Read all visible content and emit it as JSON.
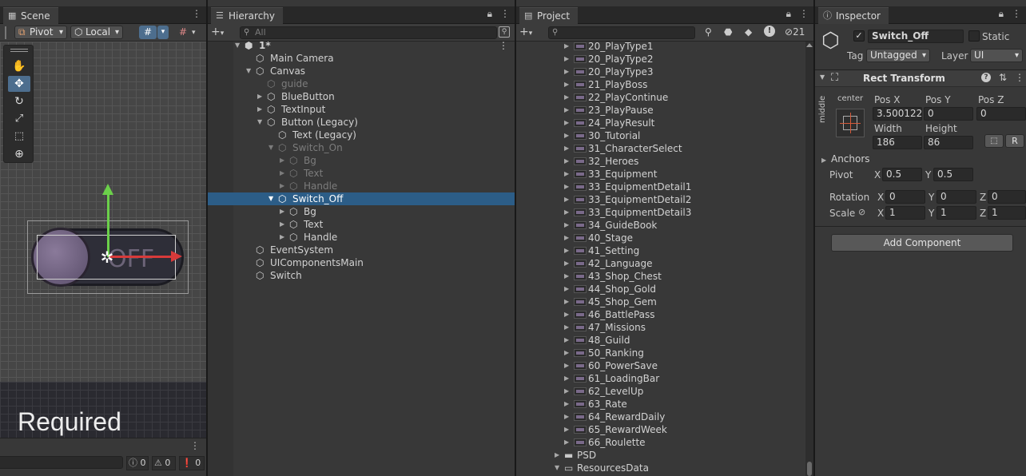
{
  "scene": {
    "tab": "Scene",
    "pivot": "Pivot",
    "local": "Local",
    "required_text": "Required",
    "switch_text": "OFF",
    "console_counts": [
      "0",
      "0",
      "0"
    ]
  },
  "hierarchy": {
    "tab": "Hierarchy",
    "search_placeholder": "All",
    "items": [
      {
        "label": "1*",
        "depth": 0
      },
      {
        "label": "Main Camera",
        "depth": 1
      },
      {
        "label": "Canvas",
        "depth": 1
      },
      {
        "label": "guide",
        "depth": 2
      },
      {
        "label": "BlueButton",
        "depth": 2
      },
      {
        "label": "TextInput",
        "depth": 2
      },
      {
        "label": "Button (Legacy)",
        "depth": 2
      },
      {
        "label": "Text (Legacy)",
        "depth": 3
      },
      {
        "label": "Switch_On",
        "depth": 3
      },
      {
        "label": "Bg",
        "depth": 4
      },
      {
        "label": "Text",
        "depth": 4
      },
      {
        "label": "Handle",
        "depth": 4
      },
      {
        "label": "Switch_Off",
        "depth": 3
      },
      {
        "label": "Bg",
        "depth": 4
      },
      {
        "label": "Text",
        "depth": 4
      },
      {
        "label": "Handle",
        "depth": 4
      },
      {
        "label": "EventSystem",
        "depth": 1
      },
      {
        "label": "UIComponentsMain",
        "depth": 1
      },
      {
        "label": "Switch",
        "depth": 1
      }
    ]
  },
  "project": {
    "tab": "Project",
    "hidden_count": "21",
    "items": [
      "20_PlayType1",
      "20_PlayType2",
      "20_PlayType3",
      "21_PlayBoss",
      "22_PlayContinue",
      "23_PlayPause",
      "24_PlayResult",
      "30_Tutorial",
      "31_CharacterSelect",
      "32_Heroes",
      "33_Equipment",
      "33_EquipmentDetail1",
      "33_EquipmentDetail2",
      "33_EquipmentDetail3",
      "34_GuideBook",
      "40_Stage",
      "41_Setting",
      "42_Language",
      "43_Shop_Chest",
      "44_Shop_Gold",
      "45_Shop_Gem",
      "46_BattlePass",
      "47_Missions",
      "48_Guild",
      "50_Ranking",
      "60_PowerSave",
      "61_LoadingBar",
      "62_LevelUp",
      "63_Rate",
      "64_RewardDaily",
      "65_RewardWeek",
      "66_Roulette"
    ],
    "folders": [
      "PSD",
      "ResourcesData"
    ]
  },
  "inspector": {
    "tab": "Inspector",
    "object_name": "Switch_Off",
    "static_label": "Static",
    "tag_label": "Tag",
    "tag_value": "Untagged",
    "layer_label": "Layer",
    "layer_value": "UI",
    "component": "Rect Transform",
    "anchor_h": "center",
    "anchor_v": "middle",
    "pos_x_label": "Pos X",
    "pos_y_label": "Pos Y",
    "pos_z_label": "Pos Z",
    "pos_x": "3.500122",
    "pos_y": "0",
    "pos_z": "0",
    "width_label": "Width",
    "height_label": "Height",
    "width": "186",
    "height": "86",
    "r_label": "R",
    "anchors_label": "Anchors",
    "pivot_label": "Pivot",
    "pivot_x": "0.5",
    "pivot_y": "0.5",
    "rotation_label": "Rotation",
    "rot_x": "0",
    "rot_y": "0",
    "rot_z": "0",
    "scale_label": "Scale",
    "scale_x": "1",
    "scale_y": "1",
    "scale_z": "1",
    "x_label": "X",
    "y_label": "Y",
    "z_label": "Z",
    "add_component": "Add Component"
  }
}
